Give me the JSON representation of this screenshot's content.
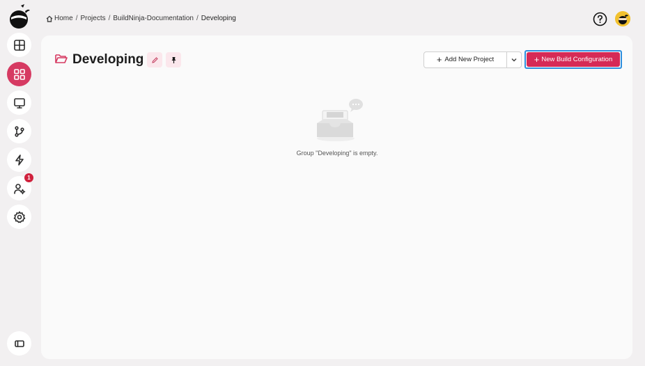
{
  "breadcrumb": {
    "items": [
      "Home",
      "Projects",
      "BuildNinja-Documentation",
      "Developing"
    ],
    "separator": "/"
  },
  "sidebar": {
    "items": [
      {
        "name": "dashboard",
        "icon": "layout-icon"
      },
      {
        "name": "projects",
        "icon": "grid-icon",
        "active": true
      },
      {
        "name": "agents",
        "icon": "monitor-icon"
      },
      {
        "name": "vcs",
        "icon": "git-branch-icon"
      },
      {
        "name": "builds",
        "icon": "lightning-icon"
      },
      {
        "name": "user-settings",
        "icon": "user-gear-icon",
        "badge": "1"
      },
      {
        "name": "settings",
        "icon": "gear-icon"
      }
    ]
  },
  "main": {
    "title": "Developing",
    "add_project_label": "Add New Project",
    "new_build_label": "New Build Configuration",
    "empty_message": "Group \"Developing\" is empty."
  },
  "colors": {
    "accent": "#d62a56",
    "focus_ring": "#2e8fde",
    "badge": "#d0213d"
  }
}
